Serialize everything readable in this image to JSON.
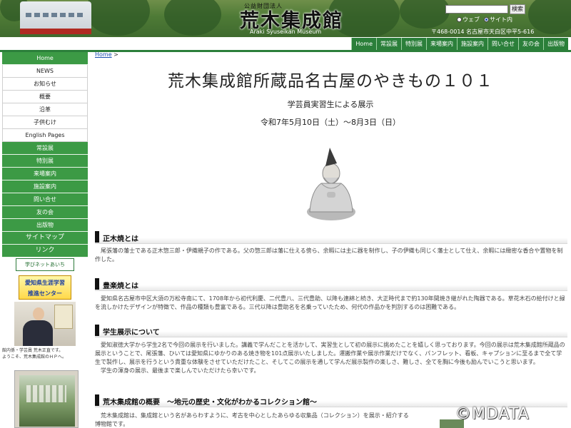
{
  "header": {
    "logo_small": "公益財団法人",
    "logo_main": "荒木集成館",
    "logo_en": "Araki Syuseikan Museum",
    "search_button": "検索",
    "radio_web": "ウェブ",
    "radio_site": "サイト内",
    "address": "〒468-0014 名古屋市天白区中平5-616"
  },
  "topnav": [
    "Home",
    "常設展",
    "特別展",
    "来場案内",
    "施設案内",
    "問い合せ",
    "友の会",
    "出版物"
  ],
  "sidebar": {
    "items": [
      {
        "label": "Home",
        "style": "green"
      },
      {
        "label": "NEWS",
        "style": "white"
      },
      {
        "label": "お知らせ",
        "style": "white"
      },
      {
        "label": "概要",
        "style": "white"
      },
      {
        "label": "沿革",
        "style": "white"
      },
      {
        "label": "子供むけ",
        "style": "white"
      },
      {
        "label": "English Pages",
        "style": "white"
      },
      {
        "label": "常設展",
        "style": "green"
      },
      {
        "label": "特別展",
        "style": "green"
      },
      {
        "label": "来場案内",
        "style": "green"
      },
      {
        "label": "施設案内",
        "style": "green"
      },
      {
        "label": "問い合せ",
        "style": "green"
      },
      {
        "label": "友の会",
        "style": "green"
      },
      {
        "label": "出版物",
        "style": "green"
      },
      {
        "label": "サイトマップ",
        "style": "green big"
      },
      {
        "label": "リンク",
        "style": "green big"
      }
    ],
    "banner_net": "学びネットあいち",
    "banner_center_line1": "愛知県生涯学習",
    "banner_center_line2": "推進センター",
    "director_caption_1": "館内係・学芸員 荒木正直です。",
    "director_caption_2": "ようこそ、荒木集成館のＨＰへ。"
  },
  "breadcrumb": {
    "home": "Home",
    "sep": " >"
  },
  "exhibit": {
    "title": "荒木集成館所蔵品名古屋のやきもの１０１",
    "subtitle": "学芸員実習生による展示",
    "dates": "令和7年5月10日（土）～8月3日（日）"
  },
  "sections": [
    {
      "heading": "正木焼とは",
      "body": "　尾張藩の藩士である正木惣三郎・伊織親子の作である。父の惣三郎は藩に仕える傍ら、余暇には主に器を制作し、子の伊織も同じく藩士として仕え、余暇には緻密な香合や置物を制作した。"
    },
    {
      "heading": "豊楽焼とは",
      "body": "　愛知県名古屋市中区大須の万松寺南にて、1708年から初代利慶、二代豊八、三代豊助、以降も連綿と続き、大正時代まで約130年間焼き継がれた陶器である。草花木石の絵付けと緑を流しかけたデザインが特徴で、作品の種類も豊富である。三代以降は豊助名を名乗っていたため、何代の作品かを判別するのは困難である。"
    },
    {
      "heading": "学生展示について",
      "body": "　愛知淑徳大学から学生2名で今回の展示を行いました。講義で学んだことを活かして、実習生として初の展示に挑めたことを嬉しく思っております。今回の展示は荒木集成館所蔵品の展示ということで、尾張藩、ひいては愛知県にゆかりのある焼き物を101点展示いたしました。運搬作業や展示作業だけでなく、パンフレット、看板、キャプションに至るまで全て学生で製作し、展示を行うという貴重な体験をさせていただけたこと、そしてこの展示を通して学んだ展示製作の楽しさ、難しさ、全てを胸に今後も励んでいこうと思います。",
      "body2": "　学生の渾身の展示、最後まで楽しんでいただけたら幸いです。"
    },
    {
      "heading": "荒木集成館の概要　～地元の歴史・文化がわかるコレクション館～",
      "body": "　荒木集成館は、集成館という名があらわすように、考古を中心としたあらゆる収集品（コレクション）を展示・紹介する",
      "body2": "博物館です。"
    }
  ],
  "watermark": "©MDATA"
}
